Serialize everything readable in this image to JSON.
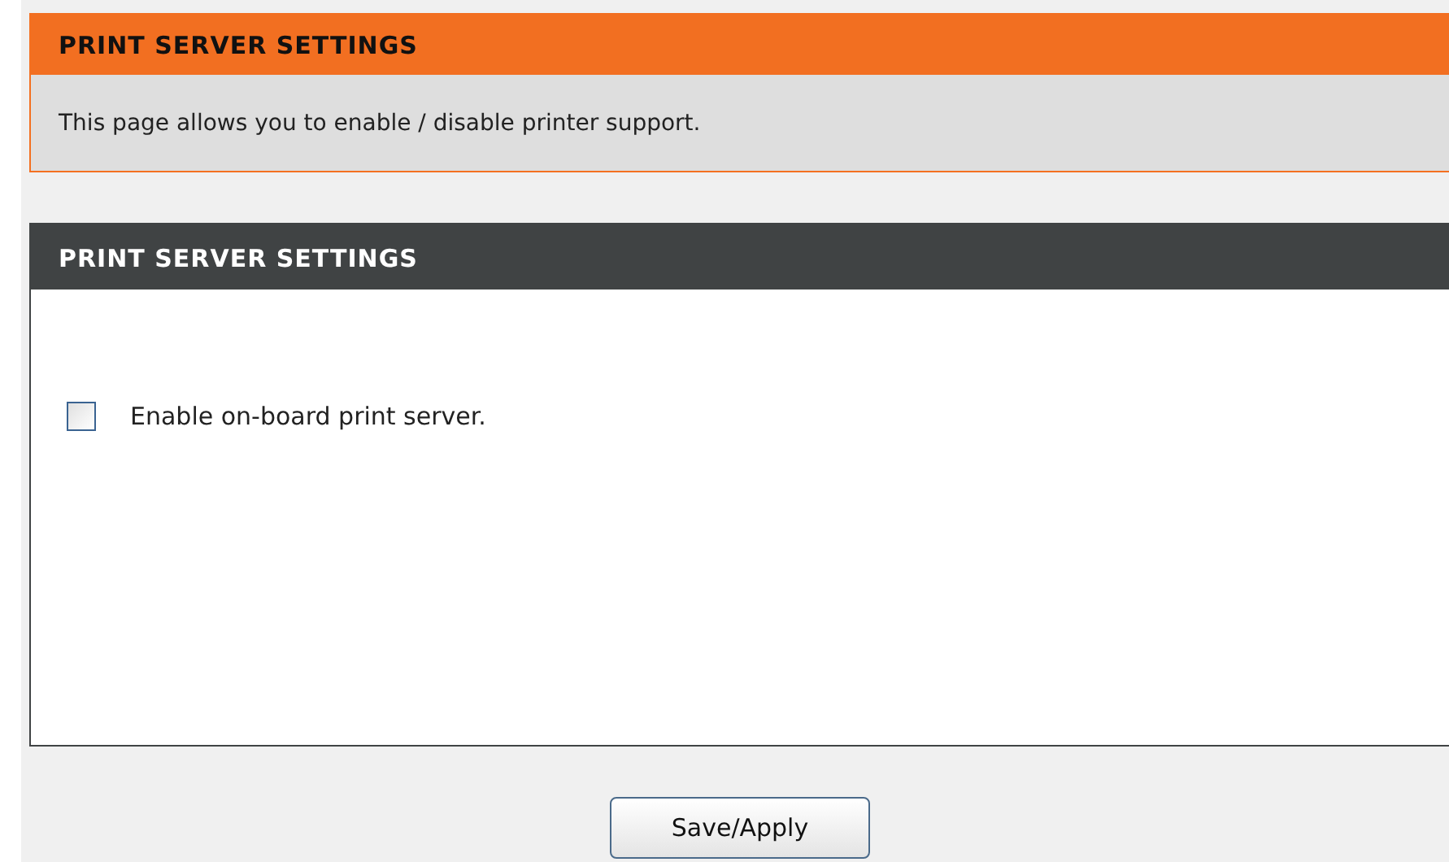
{
  "intro": {
    "title": "PRINT SERVER SETTINGS",
    "description": "This page allows you to enable / disable printer support."
  },
  "section": {
    "title": "PRINT SERVER SETTINGS",
    "option": {
      "label": "Enable on-board print server.",
      "checked": false
    }
  },
  "buttons": [
    "Save/Apply"
  ]
}
